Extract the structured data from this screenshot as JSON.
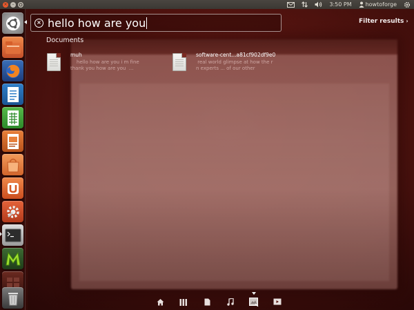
{
  "top_panel": {
    "time": "3:50 PM",
    "user": "howtoforge",
    "icons": [
      "mail-icon",
      "network-icon",
      "volume-icon",
      "user-icon",
      "gear-icon"
    ]
  },
  "launcher": {
    "items": [
      {
        "name": "dash-home",
        "icon": "ubuntu-logo-icon"
      },
      {
        "name": "home-folder",
        "icon": "folder-icon"
      },
      {
        "name": "firefox",
        "icon": "firefox-icon"
      },
      {
        "name": "writer",
        "icon": "libreoffice-writer-icon"
      },
      {
        "name": "calc",
        "icon": "libreoffice-calc-icon"
      },
      {
        "name": "impress",
        "icon": "libreoffice-impress-icon"
      },
      {
        "name": "software-center",
        "icon": "shopping-bag-icon"
      },
      {
        "name": "ubuntu-one",
        "icon": "ubuntu-one-icon"
      },
      {
        "name": "system-settings",
        "icon": "settings-icon"
      },
      {
        "name": "terminal",
        "icon": "terminal-icon"
      },
      {
        "name": "app-m",
        "icon": "m-app-icon"
      },
      {
        "name": "workspace",
        "icon": "workspace-icon"
      },
      {
        "name": "trash",
        "icon": "trash-icon"
      }
    ]
  },
  "dash": {
    "search_query": "hello how are you",
    "filter_label": "Filter results",
    "section_title": "Documents",
    "results": [
      {
        "title": "muh",
        "snippet": "    hello how are you i m fine\nthank you how are you  ..."
      },
      {
        "title": "software-cent...a81cf902df9e0",
        "snippet": " real world glimpse at how the r\nn experts ... of our other"
      }
    ]
  },
  "lens_bar": {
    "lenses": [
      "home-lens-icon",
      "applications-lens-icon",
      "files-lens-icon",
      "music-lens-icon",
      "photos-lens-icon",
      "video-lens-icon"
    ],
    "active_lens": "photos-lens-icon"
  },
  "colors": {
    "accent_orange": "#e8592c",
    "panel_dark": "#3b3833",
    "dash_bg": "#5a1712"
  }
}
